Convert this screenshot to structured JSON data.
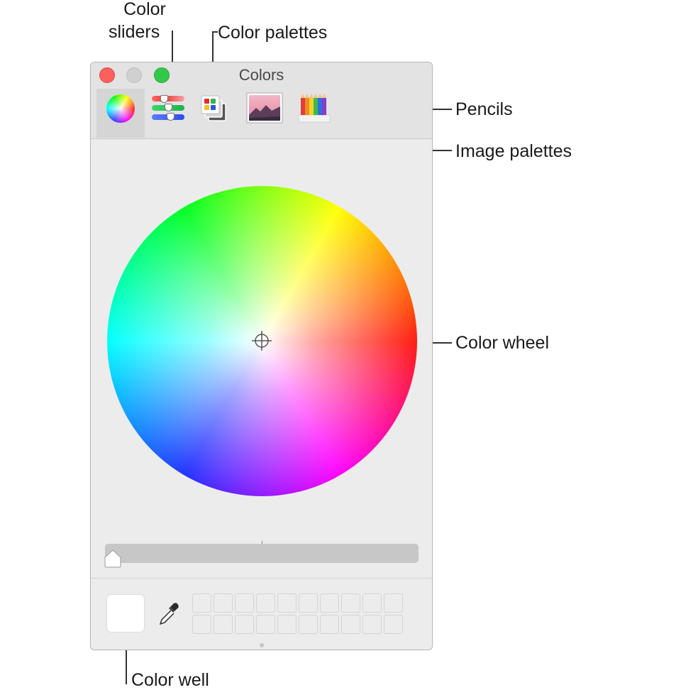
{
  "window": {
    "title": "Colors",
    "toolbar_tabs": [
      {
        "id": "color-wheel",
        "selected": true
      },
      {
        "id": "color-sliders",
        "selected": false
      },
      {
        "id": "color-palettes",
        "selected": false
      },
      {
        "id": "image-palettes",
        "selected": false
      },
      {
        "id": "pencils",
        "selected": false
      }
    ],
    "brightness_slider": {
      "value": 0
    },
    "color_well": {
      "color": "#ffffff"
    },
    "swatch_slots": 20
  },
  "callouts": {
    "color_sliders": "Color\nsliders",
    "color_sliders_line1": "Color",
    "color_sliders_line2": "sliders",
    "color_palettes": "Color palettes",
    "pencils": "Pencils",
    "image_palettes": "Image palettes",
    "color_wheel": "Color wheel",
    "color_well": "Color well"
  },
  "icons": {
    "color_wheel_tab": "color-wheel-icon",
    "sliders_tab": "sliders-icon",
    "palettes_tab": "palettes-icon",
    "image_tab": "image-landscape-icon",
    "pencils_tab": "pencils-icon",
    "eyedropper": "eyedropper-icon",
    "crosshair": "crosshair-icon"
  },
  "colors": {
    "close": "#fc605c",
    "minimize": "#d0d0d0",
    "zoom": "#34c84a",
    "window_bg": "#ececec"
  }
}
